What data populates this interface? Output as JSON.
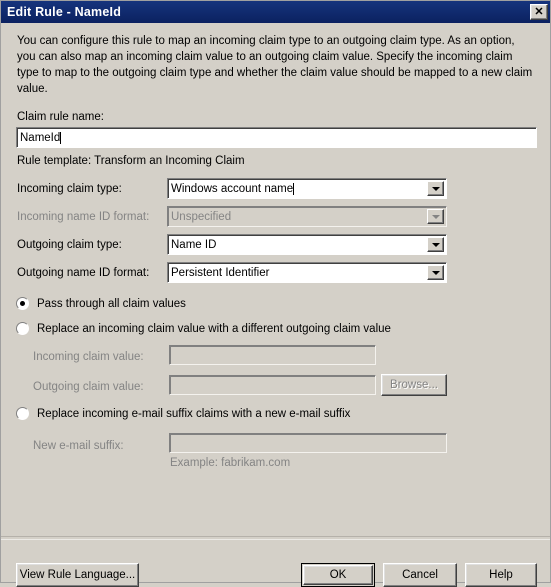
{
  "window": {
    "title": "Edit Rule - NameId",
    "close_label": "✕"
  },
  "intro": {
    "text": "You can configure this rule to map an incoming claim type to an outgoing claim type. As an option, you can also map an incoming claim value to an outgoing claim value. Specify the incoming claim type to map to the outgoing claim type and whether the claim value should be mapped to a new claim value."
  },
  "rule_name": {
    "label": "Claim rule name:",
    "value": "NameId",
    "placeholder": ""
  },
  "rule_template": {
    "text": "Rule template: Transform an Incoming Claim"
  },
  "fields": {
    "incoming_claim_type": {
      "label": "Incoming claim type:",
      "value": "Windows account name",
      "enabled": true
    },
    "incoming_name_id_format": {
      "label": "Incoming name ID format:",
      "value": "Unspecified",
      "enabled": false
    },
    "outgoing_claim_type": {
      "label": "Outgoing claim type:",
      "value": "Name ID",
      "enabled": true
    },
    "outgoing_name_id_format": {
      "label": "Outgoing name ID format:",
      "value": "Persistent Identifier",
      "enabled": true
    }
  },
  "options": {
    "pass_through": {
      "label": "Pass through all claim values",
      "selected": true
    },
    "replace_value": {
      "label": "Replace an incoming claim value with a different outgoing claim value",
      "selected": false,
      "incoming_value_label": "Incoming claim value:",
      "incoming_value": "",
      "outgoing_value_label": "Outgoing claim value:",
      "outgoing_value": "",
      "browse_label": "Browse..."
    },
    "replace_email_suffix": {
      "label": "Replace incoming e-mail suffix claims with a new e-mail suffix",
      "selected": false,
      "new_suffix_label": "New e-mail suffix:",
      "new_suffix_value": "",
      "example_text": "Example: fabrikam.com"
    }
  },
  "footer": {
    "view_rule_language": "View Rule Language...",
    "ok": "OK",
    "cancel": "Cancel",
    "help": "Help"
  },
  "colors": {
    "titlebar": "#0f2a6b",
    "dialog_bg": "#d4d0c8",
    "disabled_text": "#848484",
    "field_bg": "#ffffff"
  }
}
